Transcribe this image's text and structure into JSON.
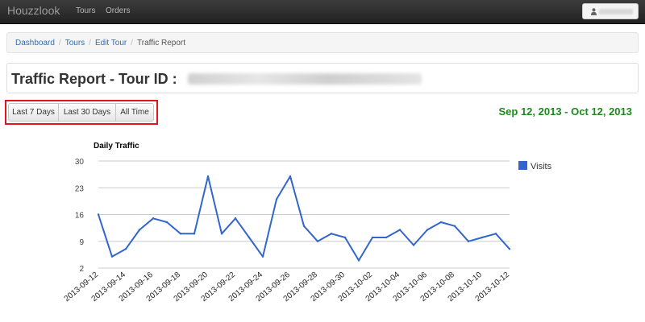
{
  "navbar": {
    "brand": "Houzzlook",
    "links": [
      "Tours",
      "Orders"
    ]
  },
  "breadcrumb": {
    "items": [
      "Dashboard",
      "Tours",
      "Edit Tour"
    ],
    "active": "Traffic Report"
  },
  "page": {
    "title": "Traffic Report - Tour ID :"
  },
  "filters": {
    "buttons": [
      "Last 7 Days",
      "Last 30 Days",
      "All Time"
    ],
    "date_range": "Sep 12, 2013 - Oct 12, 2013"
  },
  "colors": {
    "accent_green": "#1d8a1d",
    "series_blue": "#3366cc",
    "highlight_red": "#e4141a"
  },
  "chart_data": {
    "type": "line",
    "title": "Daily Traffic",
    "xlabel": "",
    "ylabel": "",
    "y_ticks": [
      2,
      9,
      16,
      23,
      30
    ],
    "ylim": [
      2,
      30
    ],
    "x_tick_labels": [
      "2013-09-12",
      "2013-09-14",
      "2013-09-16",
      "2013-09-18",
      "2013-09-20",
      "2013-09-22",
      "2013-09-24",
      "2013-09-26",
      "2013-09-28",
      "2013-09-30",
      "2013-10-02",
      "2013-10-04",
      "2013-10-06",
      "2013-10-08",
      "2013-10-10",
      "2013-10-12"
    ],
    "grid": true,
    "legend_position": "right",
    "series": [
      {
        "name": "Visits",
        "x": [
          "2013-09-12",
          "2013-09-13",
          "2013-09-14",
          "2013-09-15",
          "2013-09-16",
          "2013-09-17",
          "2013-09-18",
          "2013-09-19",
          "2013-09-20",
          "2013-09-21",
          "2013-09-22",
          "2013-09-23",
          "2013-09-24",
          "2013-09-25",
          "2013-09-26",
          "2013-09-27",
          "2013-09-28",
          "2013-09-29",
          "2013-09-30",
          "2013-10-01",
          "2013-10-02",
          "2013-10-03",
          "2013-10-04",
          "2013-10-05",
          "2013-10-06",
          "2013-10-07",
          "2013-10-08",
          "2013-10-09",
          "2013-10-10",
          "2013-10-11",
          "2013-10-12"
        ],
        "values": [
          16,
          5,
          7,
          12,
          15,
          14,
          11,
          11,
          26,
          11,
          15,
          10,
          5,
          20,
          26,
          13,
          9,
          11,
          10,
          4,
          10,
          10,
          12,
          8,
          12,
          14,
          13,
          9,
          10,
          11,
          7
        ]
      }
    ]
  }
}
